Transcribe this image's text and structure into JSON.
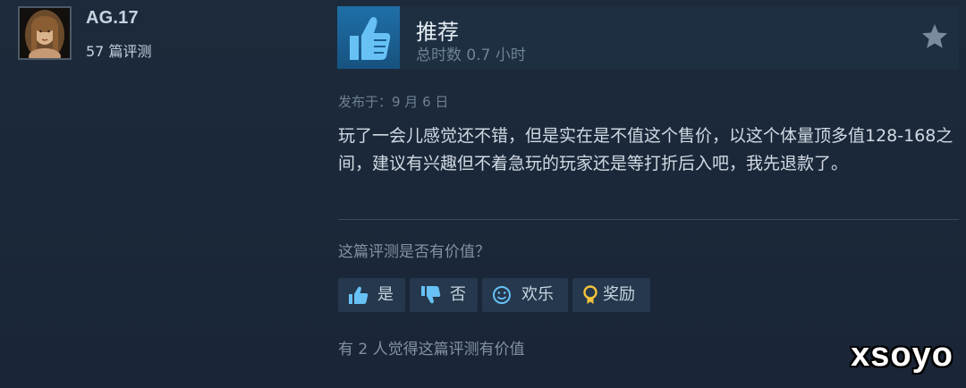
{
  "author": {
    "name": "AG.17",
    "review_count": "57 篇评测"
  },
  "review": {
    "recommendation": "推荐",
    "hours": "总时数 0.7 小时",
    "posted": "发布于：9 月 6 日",
    "body": "玩了一会儿感觉还不错，但是实在是不值这个售价，以这个体量顶多值128-168之间，建议有兴趣但不着急玩的玩家还是等打折后入吧，我先退款了。"
  },
  "feedback": {
    "question": "这篇评测是否有价值？",
    "buttons": {
      "yes": "是",
      "no": "否",
      "funny": "欢乐",
      "award": "奖励"
    },
    "helpful_count": "有 2 人觉得这篇评测有价值"
  },
  "watermark": "xsoyo",
  "icons": {
    "recommend": "thumbs-up-icon",
    "award_star": "star-icon",
    "yes": "thumbs-up-icon",
    "no": "thumbs-down-icon",
    "funny": "smiley-icon",
    "award": "award-ribbon-icon"
  },
  "colors": {
    "background": "#1b2838",
    "thumb_blue": "#67c1f5",
    "award_gold": "#f5c33b"
  }
}
